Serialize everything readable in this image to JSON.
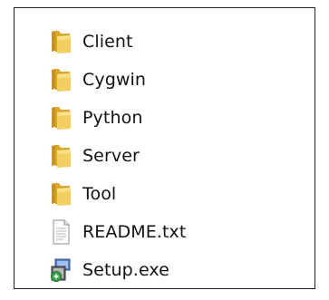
{
  "files": [
    {
      "name": "Client",
      "type": "folder",
      "icon": "folder-icon"
    },
    {
      "name": "Cygwin",
      "type": "folder",
      "icon": "folder-icon"
    },
    {
      "name": "Python",
      "type": "folder",
      "icon": "folder-icon"
    },
    {
      "name": "Server",
      "type": "folder",
      "icon": "folder-icon"
    },
    {
      "name": "Tool",
      "type": "folder",
      "icon": "folder-icon"
    },
    {
      "name": "README.txt",
      "type": "text",
      "icon": "text-file-icon"
    },
    {
      "name": "Setup.exe",
      "type": "exe",
      "icon": "installer-icon"
    }
  ],
  "colors": {
    "folder_back": "#d9a72c",
    "folder_front": "#f3cf62",
    "text_file": "#ffffff",
    "border": "#222222"
  }
}
